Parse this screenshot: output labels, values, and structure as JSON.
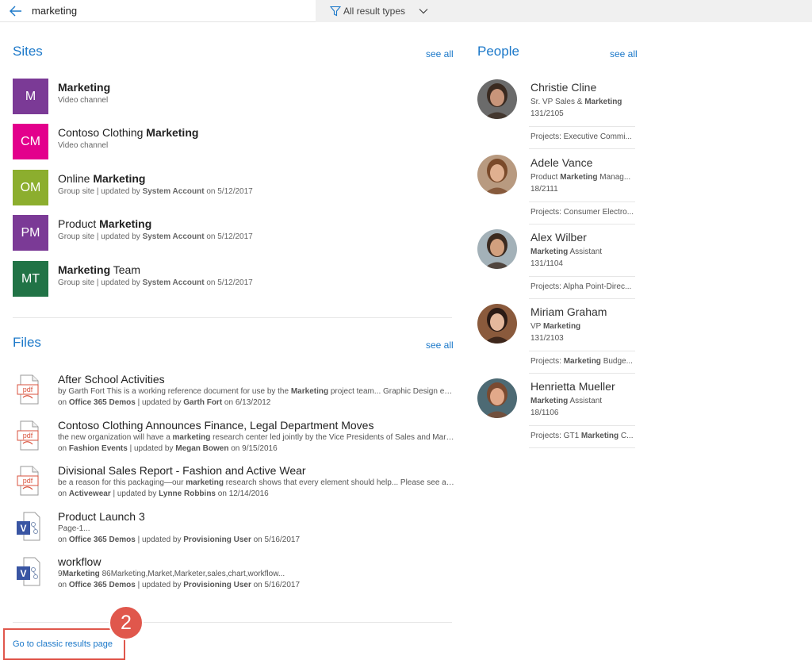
{
  "search": {
    "query": "marketing"
  },
  "filter": {
    "label": "All result types"
  },
  "sites": {
    "heading": "Sites",
    "see_all": "see all",
    "items": [
      {
        "initials": "M",
        "color": "#7b3a96",
        "title_pre": "",
        "title_hl": "Marketing",
        "title_post": "",
        "sub_pre": "Video channel",
        "sub_by": "",
        "sub_post": ""
      },
      {
        "initials": "CM",
        "color": "#e3008c",
        "title_pre": "Contoso Clothing ",
        "title_hl": "Marketing",
        "title_post": "",
        "sub_pre": "Video channel",
        "sub_by": "",
        "sub_post": ""
      },
      {
        "initials": "OM",
        "color": "#8cae2e",
        "title_pre": "Online ",
        "title_hl": "Marketing",
        "title_post": "",
        "sub_pre": "Group site | updated by ",
        "sub_by": "System Account",
        "sub_post": " on 5/12/2017"
      },
      {
        "initials": "PM",
        "color": "#7b3a96",
        "title_pre": "Product ",
        "title_hl": "Marketing",
        "title_post": "",
        "sub_pre": "Group site | updated by ",
        "sub_by": "System Account",
        "sub_post": " on 5/12/2017"
      },
      {
        "initials": "MT",
        "color": "#217346",
        "title_pre": "",
        "title_hl": "Marketing",
        "title_post": " Team",
        "sub_pre": "Group site | updated by ",
        "sub_by": "System Account",
        "sub_post": " on 5/12/2017"
      }
    ]
  },
  "files": {
    "heading": "Files",
    "see_all": "see all",
    "items": [
      {
        "type": "pdf",
        "title": "After School Activities",
        "snip_a": "by Garth Fort This is a working reference document for use by the ",
        "snip_b": "Marketing",
        "snip_c": " project team... Graphic Design er Karina L...",
        "loc": "Office 365 Demos",
        "by": "Garth Fort",
        "date": "6/13/2012"
      },
      {
        "type": "pdf",
        "title": "Contoso Clothing Announces Finance, Legal Department Moves",
        "snip_a": "the new organization will have a ",
        "snip_b": "marketing",
        "snip_c": " research center led jointly by the Vice Presidents of Sales and Marketing...",
        "loc": "Fashion Events",
        "by": "Megan Bowen",
        "date": "9/15/2016"
      },
      {
        "type": "pdf",
        "title": "Divisional Sales Report - Fashion and Active Wear",
        "snip_a": "be a reason for this packaging—our ",
        "snip_b": "marketing",
        "snip_c": " research shows that every element should help... Please see accompany...",
        "loc": "Activewear",
        "by": "Lynne Robbins",
        "date": "12/14/2016"
      },
      {
        "type": "visio",
        "title": "Product Launch 3",
        "snip_a": "Page-1...",
        "snip_b": "",
        "snip_c": "",
        "loc": "Office 365 Demos",
        "by": "Provisioning User",
        "date": "5/16/2017"
      },
      {
        "type": "visio",
        "title": "workflow",
        "snip_a": "9",
        "snip_b": "Marketing",
        "snip_c": " 86Marketing,Market,Marketer,sales,chart,workflow...",
        "loc": "Office 365 Demos",
        "by": "Provisioning User",
        "date": "5/16/2017"
      }
    ],
    "meta_on": "on ",
    "meta_updated": " | updated by ",
    "meta_on2": " on "
  },
  "people": {
    "heading": "People",
    "see_all": "see all",
    "items": [
      {
        "name": "Christie Cline",
        "title": "Sr. VP Sales & Marketing",
        "office": "131/2105",
        "projects": "Projects: Executive Commi...",
        "skin": "#c8957a",
        "hair": "#3a2a20",
        "bg": "#6b6b6b"
      },
      {
        "name": "Adele Vance",
        "title": "Product Marketing Manag...",
        "office": "18/2111",
        "projects": "Projects: Consumer Electro...",
        "skin": "#e0b090",
        "hair": "#7a4a2a",
        "bg": "#b89a80"
      },
      {
        "name": "Alex Wilber",
        "title": "Marketing Assistant",
        "office": "131/1104",
        "projects": "Projects: Alpha Point-Direc...",
        "skin": "#d2a07e",
        "hair": "#3b2a1f",
        "bg": "#a3b1b8"
      },
      {
        "name": "Miriam Graham",
        "title": "VP Marketing",
        "office": "131/2103",
        "projects": "Projects: Marketing Budge...",
        "skin": "#e4b89c",
        "hair": "#2a1a14",
        "bg": "#8a5a3c"
      },
      {
        "name": "Henrietta Mueller",
        "title": "Marketing Assistant",
        "office": "18/1106",
        "projects": "Projects: GT1 Marketing C...",
        "skin": "#e2a98a",
        "hair": "#7a4a30",
        "bg": "#4d6a74"
      }
    ]
  },
  "footer": {
    "classic_link": "Go to classic results page",
    "callout_number": "2",
    "callout_color": "#e0574c"
  },
  "colors": {
    "accent": "#1b78c9"
  }
}
